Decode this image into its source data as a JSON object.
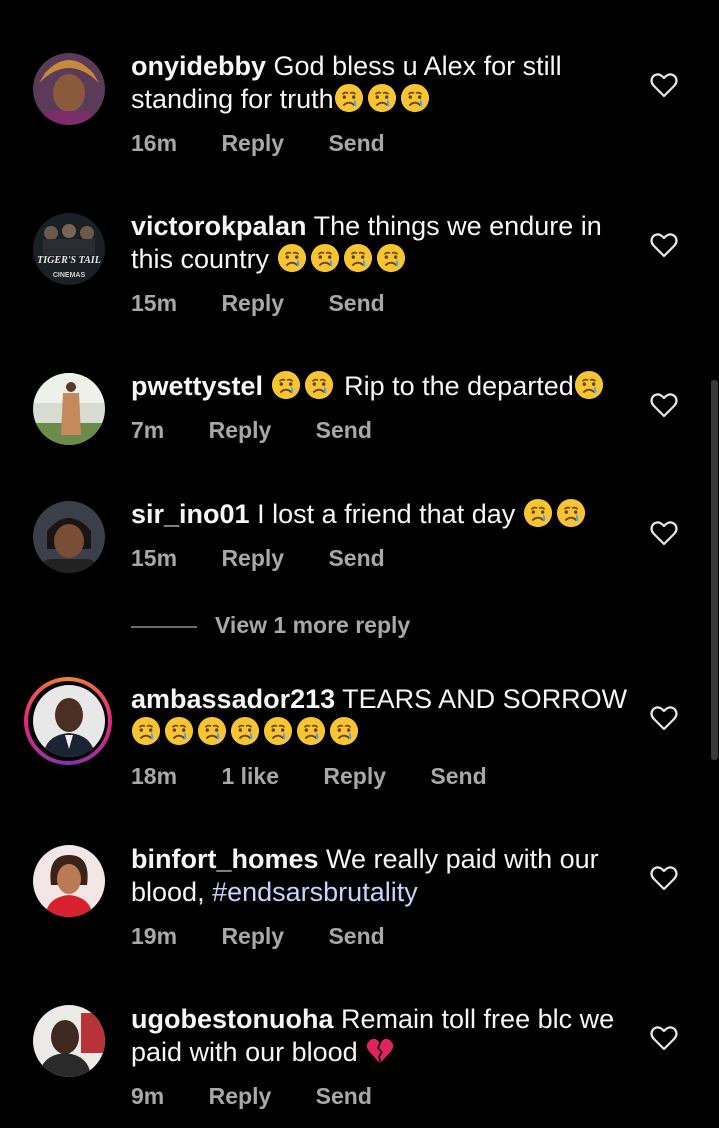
{
  "comments": [
    {
      "username": "onyidebby",
      "text": "God bless u Alex for still standing for truth",
      "emoji_after": 3,
      "time": "16m",
      "likes": "",
      "reply": "Reply",
      "send": "Send",
      "avatar": "woman-headwrap-avatar"
    },
    {
      "username": "victorokpalan",
      "text": "The things we endure in this country",
      "emoji_after": 4,
      "time": "15m",
      "likes": "",
      "reply": "Reply",
      "send": "Send",
      "avatar": "movie-poster-avatar",
      "avatar_text_1": "TIGER'S TAIL",
      "avatar_text_2": "CINEMAS"
    },
    {
      "username": "pwettystel",
      "text": "Rip to the departed",
      "emoji_before": 2,
      "emoji_after": 1,
      "time": "7m",
      "likes": "",
      "reply": "Reply",
      "send": "Send",
      "avatar": "person-standing-avatar"
    },
    {
      "username": "sir_ino01",
      "text": "I lost a friend that day",
      "emoji_after": 2,
      "time": "15m",
      "likes": "",
      "reply": "Reply",
      "send": "Send",
      "avatar": "woman-avatar"
    },
    {
      "username": "ambassador213",
      "text": "TEARS AND SORROW",
      "emoji_after": 7,
      "time": "18m",
      "likes": "1 like",
      "reply": "Reply",
      "send": "Send",
      "avatar": "man-suit-avatar",
      "story_ring": true
    },
    {
      "username": "binfort_homes",
      "text": "We really paid with our blood,",
      "hashtag": "#endsarsbrutality",
      "time": "19m",
      "likes": "",
      "reply": "Reply",
      "send": "Send",
      "avatar": "woman-red-avatar"
    },
    {
      "username": "ugobestonuoha",
      "text": "Remain toll free blc we paid with our blood",
      "broken_heart": true,
      "time": "9m",
      "likes": "",
      "reply": "Reply",
      "send": "Send",
      "avatar": "man-portrait-avatar"
    }
  ],
  "view_more": "View 1 more reply",
  "colors": {
    "background": "#000000",
    "text": "#f5f5f5",
    "meta": "#a8a8a8",
    "hashtag": "#c8d4ff",
    "emoji": "#f7c531",
    "tear": "#4aa3ff",
    "broken_heart": "#e0245e"
  }
}
